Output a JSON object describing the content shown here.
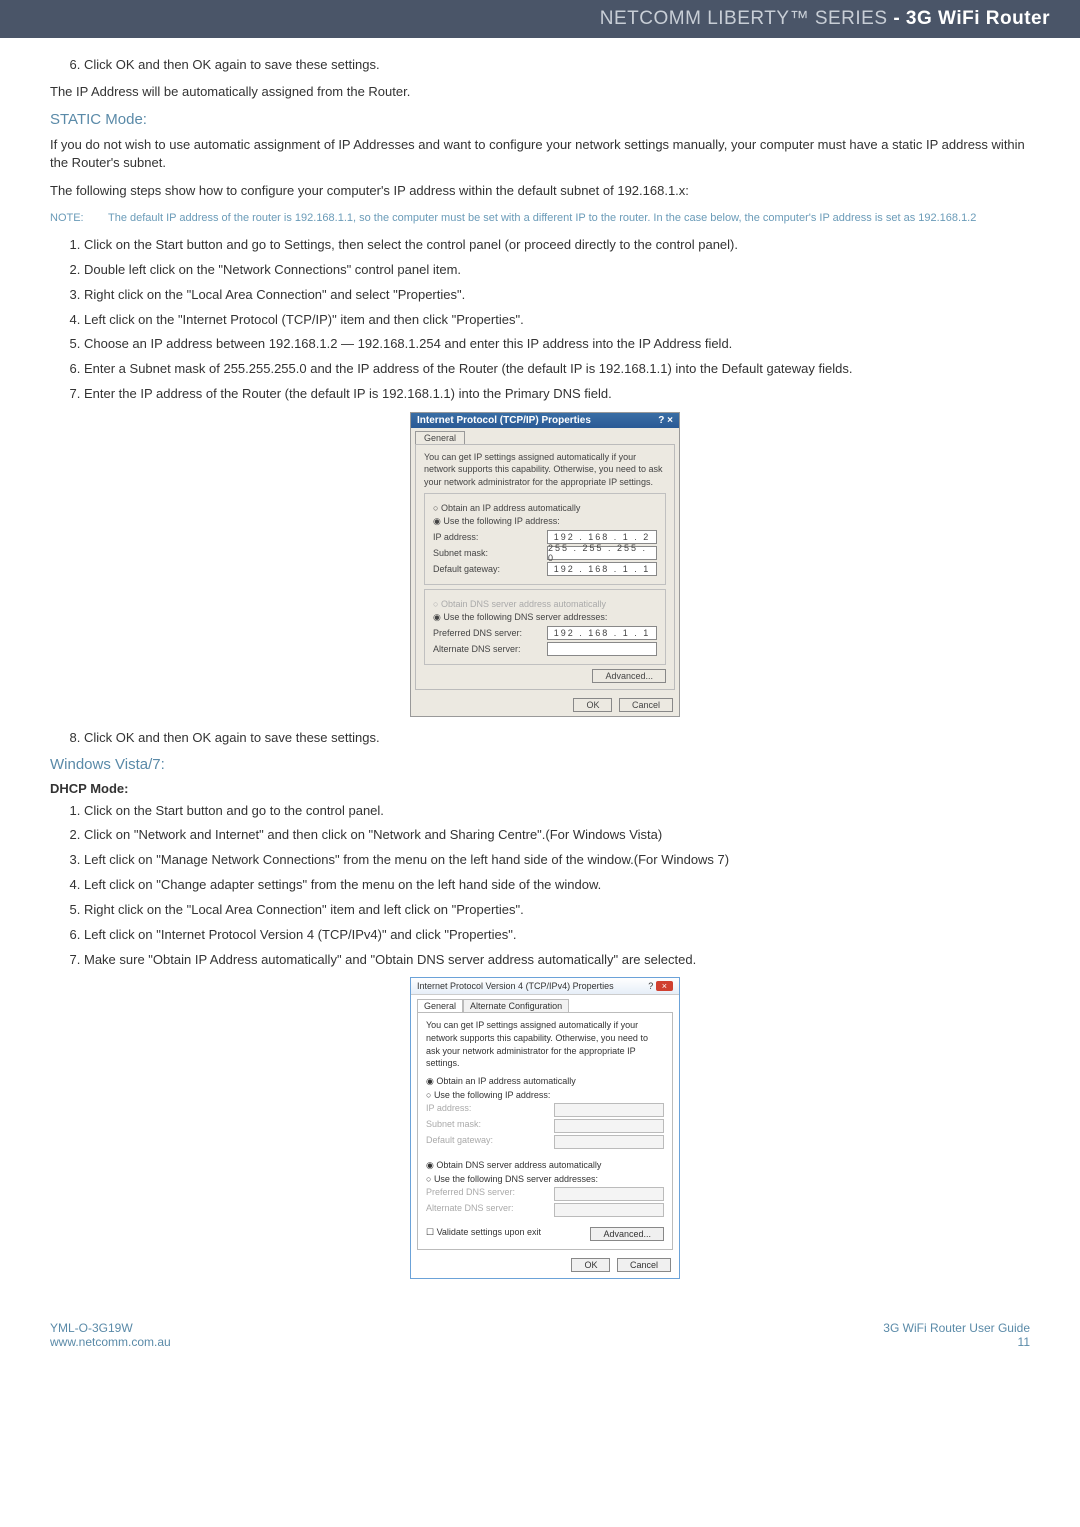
{
  "header": {
    "brand": "NETCOMM LIBERTY™ SERIES",
    "suffix": " - 3G WiFi Router"
  },
  "top_list": {
    "item6": "Click OK and then OK again to save these settings."
  },
  "p_auto": "The IP Address will be automatically assigned from the Router.",
  "static_mode": {
    "heading": "STATIC Mode:",
    "p1": "If you do not wish to use automatic assignment of IP Addresses and want to configure your network settings manually, your computer must have a static IP address within the Router's subnet.",
    "p2": "The following steps show how to configure your computer's IP address within the default subnet of 192.168.1.x:",
    "note_label": "NOTE:",
    "note_text": "The default IP address of the router is 192.168.1.1, so the computer must be set with a different IP to the router. In the case below, the computer's IP address is set as 192.168.1.2",
    "steps": [
      "Click on the Start button and go to Settings, then select the control panel (or proceed directly to the control panel).",
      "Double left click on the \"Network Connections\" control panel item.",
      "Right click on the \"Local Area Connection\" and select \"Properties\".",
      "Left click on the \"Internet Protocol (TCP/IP)\" item and then click \"Properties\".",
      "Choose an IP address between 192.168.1.2 — 192.168.1.254 and enter this IP address into the IP Address field.",
      "Enter a Subnet mask of 255.255.255.0 and the IP address of the Router (the default IP is 192.168.1.1) into the Default gateway fields.",
      "Enter the IP address of the Router (the default IP is 192.168.1.1) into the Primary DNS field."
    ],
    "step8": "Click OK and then OK again to save these settings."
  },
  "dialog_xp": {
    "title": "Internet Protocol (TCP/IP) Properties",
    "tab": "General",
    "intro": "You can get IP settings assigned automatically if your network supports this capability. Otherwise, you need to ask your network administrator for the appropriate IP settings.",
    "radio_auto": "Obtain an IP address automatically",
    "radio_manual": "Use the following IP address:",
    "ip_label": "IP address:",
    "ip_value": "192 . 168 .  1  .  2",
    "subnet_label": "Subnet mask:",
    "subnet_value": "255 . 255 . 255 .  0",
    "gateway_label": "Default gateway:",
    "gateway_value": "192 . 168 .  1  .  1",
    "dns_auto": "Obtain DNS server address automatically",
    "dns_manual": "Use the following DNS server addresses:",
    "pref_dns_label": "Preferred DNS server:",
    "pref_dns_value": "192 . 168 .  1  .  1",
    "alt_dns_label": "Alternate DNS server:",
    "advanced_btn": "Advanced...",
    "ok_btn": "OK",
    "cancel_btn": "Cancel"
  },
  "vista": {
    "heading": "Windows Vista/7:",
    "dhcp_heading": "DHCP Mode:",
    "steps": [
      "Click on the Start button and go to the control panel.",
      "Click on \"Network and Internet\" and then click on \"Network and Sharing Centre\".(For Windows Vista)",
      "Left click on \"Manage Network Connections\" from the menu on the left hand side of the window.(For Windows 7)",
      "Left click on \"Change adapter settings\" from the menu on the left hand side of the window.",
      "Right click on the \"Local Area Connection\" item and left click on \"Properties\".",
      "Left click on \"Internet Protocol Version 4 (TCP/IPv4)\" and click \"Properties\".",
      "Make sure \"Obtain IP Address automatically\" and \"Obtain DNS server address automatically\" are selected."
    ]
  },
  "dialog_vista": {
    "title": "Internet Protocol Version 4 (TCP/IPv4) Properties",
    "tab_general": "General",
    "tab_alt": "Alternate Configuration",
    "intro": "You can get IP settings assigned automatically if your network supports this capability. Otherwise, you need to ask your network administrator for the appropriate IP settings.",
    "radio_auto": "Obtain an IP address automatically",
    "radio_manual": "Use the following IP address:",
    "ip_label": "IP address:",
    "subnet_label": "Subnet mask:",
    "gateway_label": "Default gateway:",
    "dns_auto": "Obtain DNS server address automatically",
    "dns_manual": "Use the following DNS server addresses:",
    "pref_dns_label": "Preferred DNS server:",
    "alt_dns_label": "Alternate DNS server:",
    "validate": "Validate settings upon exit",
    "advanced_btn": "Advanced...",
    "ok_btn": "OK",
    "cancel_btn": "Cancel"
  },
  "footer": {
    "left1": "YML-O-3G19W",
    "left2": "www.netcomm.com.au",
    "right1": "3G WiFi Router User Guide",
    "right2": "11"
  }
}
